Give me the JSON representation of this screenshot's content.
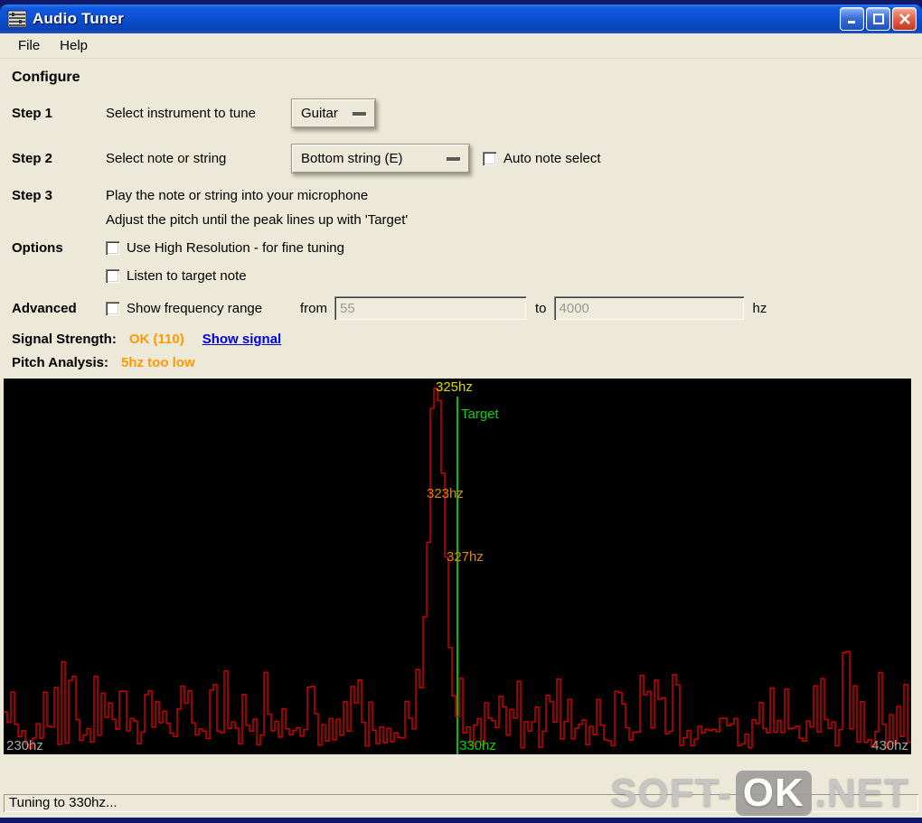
{
  "window": {
    "title": "Audio Tuner"
  },
  "menu": {
    "items": [
      {
        "label": "File"
      },
      {
        "label": "Help"
      }
    ]
  },
  "configure": {
    "heading": "Configure",
    "step1": {
      "label": "Step 1",
      "text": "Select instrument to tune",
      "dropdown_value": "Guitar"
    },
    "step2": {
      "label": "Step 2",
      "text": "Select note or string",
      "dropdown_value": "Bottom string (E)",
      "checkbox_label": "Auto note select"
    },
    "step3": {
      "label": "Step 3",
      "line1": "Play the note or string into your microphone",
      "line2": "Adjust the pitch until the peak lines up with 'Target'"
    },
    "options": {
      "label": "Options",
      "checkbox1_label": "Use High Resolution - for fine tuning",
      "checkbox2_label": "Listen to target note"
    },
    "advanced": {
      "label": "Advanced",
      "checkbox_label": "Show frequency range",
      "from_label": "from",
      "from_value": "55",
      "to_label": "to",
      "to_value": "4000",
      "unit": "hz"
    }
  },
  "signal": {
    "label": "Signal Strength:",
    "value": "OK (110)",
    "link": "Show signal"
  },
  "pitch": {
    "label": "Pitch Analysis:",
    "value": "5hz too low"
  },
  "spectrum": {
    "peak_label": "325hz",
    "target_label": "Target",
    "left_peak_label": "323hz",
    "right_peak_label": "327hz",
    "axis_left": "230hz",
    "axis_center": "330hz",
    "axis_right": "430hz",
    "freq_min": 230,
    "freq_max": 430,
    "target_freq": 330,
    "peak_freq": 325.5,
    "colors": {
      "trace": "#cc0000",
      "target": "#00c000",
      "peak_label": "#d8d800",
      "side_label": "#dd8800",
      "target_label": "#00d800",
      "axis": "#a8a8a8"
    }
  },
  "status": {
    "text": "Tuning to 330hz..."
  },
  "watermark": {
    "prefix": "SOFT-",
    "mid": "OK",
    "suffix": ".NET"
  }
}
